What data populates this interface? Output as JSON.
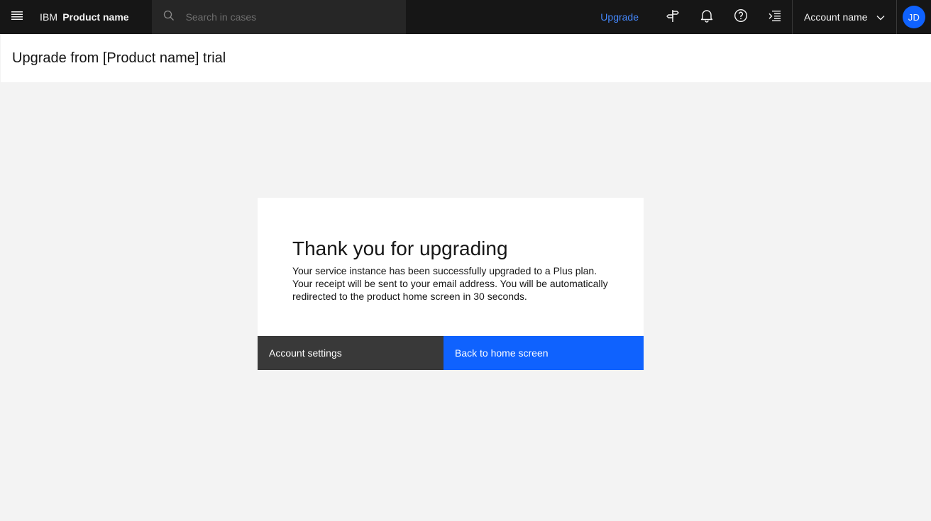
{
  "header": {
    "brand_prefix": "IBM",
    "brand_name": "Product name",
    "search_placeholder": "Search in cases",
    "upgrade_label": "Upgrade",
    "account_label": "Account name",
    "avatar_initials": "JD",
    "icons": [
      "menu-icon",
      "search-icon",
      "signpost-icon",
      "notification-icon",
      "help-icon",
      "switcher-icon",
      "chevron-down-icon"
    ]
  },
  "page": {
    "title": "Upgrade from [Product name] trial"
  },
  "modal": {
    "heading": "Thank you for upgrading",
    "body": "Your service instance has been successfully upgraded to a Plus plan. Your receipt will be sent to your email address. You will be automatically redirected to the product home screen in 30 seconds.",
    "secondary_button": "Account settings",
    "primary_button": "Back to home screen"
  },
  "colors": {
    "header_bg": "#161616",
    "search_bg": "#262626",
    "link_blue": "#4589ff",
    "primary_blue": "#0f62fe",
    "secondary_btn": "#393939",
    "page_bg": "#f3f3f3"
  }
}
